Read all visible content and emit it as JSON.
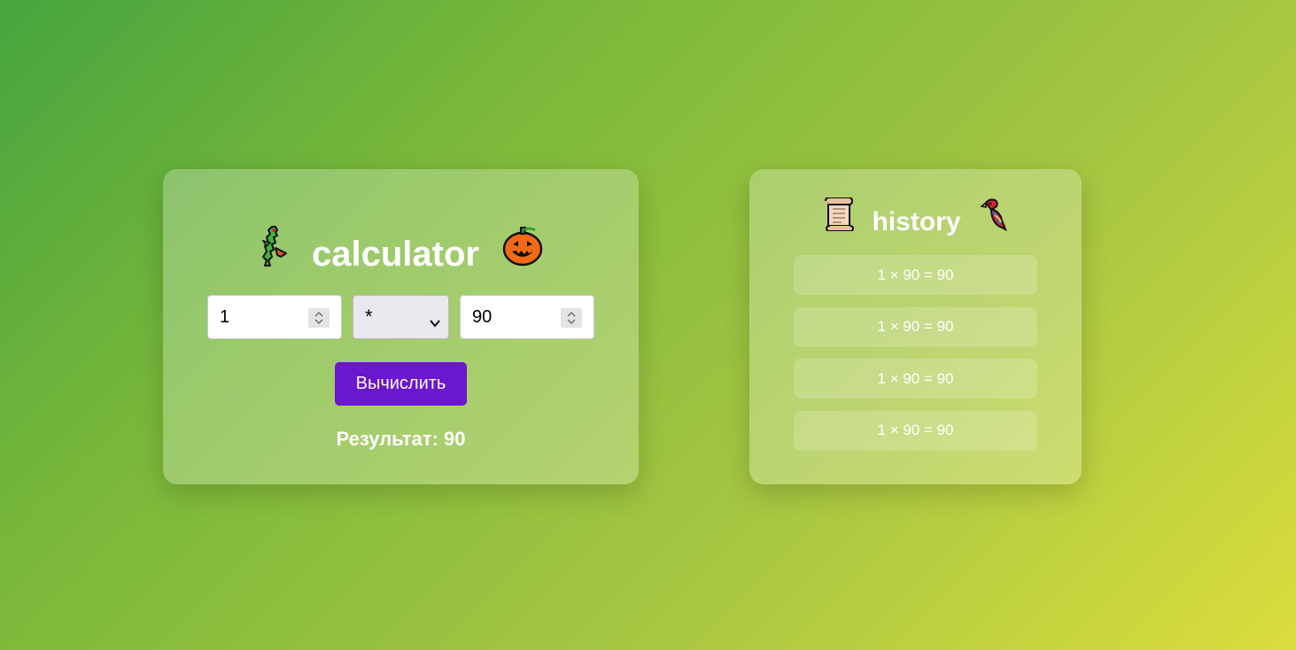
{
  "calculator": {
    "title": "calculator",
    "left_icon": "dragon-icon",
    "right_icon": "jack-o-lantern-icon",
    "operand_a": "1",
    "operator": "*",
    "operand_b": "90",
    "button_label": "Вычислить",
    "result_text": "Результат: 90"
  },
  "history": {
    "title": "history",
    "left_icon": "scroll-icon",
    "right_icon": "parrot-icon",
    "items": [
      "1 × 90 = 90",
      "1 × 90 = 90",
      "1 × 90 = 90",
      "1 × 90 = 90"
    ]
  },
  "colors": {
    "button": "#6b16d0",
    "gradient_start": "#46a43f",
    "gradient_end": "#dadd3c"
  }
}
